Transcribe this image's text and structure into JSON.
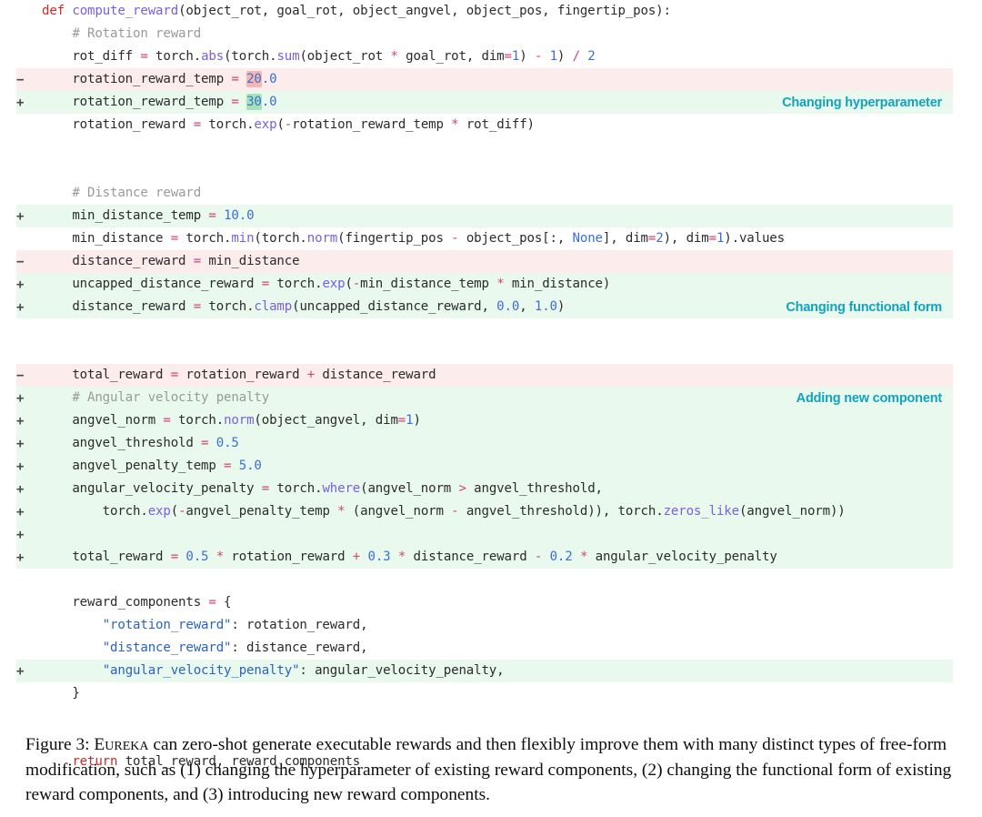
{
  "figure": {
    "label": "Figure 3:",
    "caption_entity": "Eureka",
    "caption_text": " can zero-shot generate executable rewards and then flexibly improve them with many distinct types of free-form modification, such as (1) changing the hyperparameter of existing reward components, (2) changing the functional form of existing reward components, and (3) introducing new reward components."
  },
  "colors": {
    "annotation": "#11a3bd",
    "added_row_bg": "#e9f9ee",
    "deleted_row_bg": "#fceceb",
    "added_token_highlight": "#a7e3b8",
    "deleted_token_highlight": "#f6b7b2",
    "keyword": "#cf2a27",
    "function": "#7b5ee0",
    "operator": "#d6427a",
    "number": "#3b6fd4",
    "string": "#2a62c4",
    "comment": "#9a9a9a"
  },
  "markers": {
    "add": "+",
    "del": "−",
    "none": ""
  },
  "annotations": {
    "hyperparameter": "Changing hyperparameter",
    "functional_form": "Changing functional form",
    "new_component": "Adding new component"
  },
  "code": {
    "lines": [
      {
        "marker": "",
        "type": "ctx",
        "text": "def compute_reward(object_rot, goal_rot, object_angvel, object_pos, fingertip_pos):",
        "annotation": ""
      },
      {
        "marker": "",
        "type": "ctx",
        "text": "    # Rotation reward",
        "annotation": ""
      },
      {
        "marker": "",
        "type": "ctx",
        "text": "    rot_diff = torch.abs(torch.sum(object_rot * goal_rot, dim=1) - 1) / 2",
        "annotation": ""
      },
      {
        "marker": "−",
        "type": "del",
        "text": "    rotation_reward_temp = 20.0",
        "annotation": ""
      },
      {
        "marker": "+",
        "type": "add",
        "text": "    rotation_reward_temp = 30.0",
        "annotation": "Changing hyperparameter"
      },
      {
        "marker": "",
        "type": "ctx",
        "text": "    rotation_reward = torch.exp(-rotation_reward_temp * rot_diff)",
        "annotation": ""
      },
      {
        "marker": "",
        "type": "ctx",
        "text": "",
        "annotation": ""
      },
      {
        "marker": "",
        "type": "ctx",
        "text": "",
        "annotation": ""
      },
      {
        "marker": "",
        "type": "ctx",
        "text": "    # Distance reward",
        "annotation": ""
      },
      {
        "marker": "+",
        "type": "add",
        "text": "    min_distance_temp = 10.0",
        "annotation": ""
      },
      {
        "marker": "",
        "type": "ctx",
        "text": "    min_distance = torch.min(torch.norm(fingertip_pos - object_pos[:, None], dim=2), dim=1).values",
        "annotation": ""
      },
      {
        "marker": "−",
        "type": "del",
        "text": "    distance_reward = min_distance",
        "annotation": ""
      },
      {
        "marker": "+",
        "type": "add",
        "text": "    uncapped_distance_reward = torch.exp(-min_distance_temp * min_distance)",
        "annotation": ""
      },
      {
        "marker": "+",
        "type": "add",
        "text": "    distance_reward = torch.clamp(uncapped_distance_reward, 0.0, 1.0)",
        "annotation": "Changing functional form"
      },
      {
        "marker": "",
        "type": "ctx",
        "text": "",
        "annotation": ""
      },
      {
        "marker": "",
        "type": "ctx",
        "text": "",
        "annotation": ""
      },
      {
        "marker": "−",
        "type": "del",
        "text": "    total_reward = rotation_reward + distance_reward",
        "annotation": ""
      },
      {
        "marker": "+",
        "type": "add",
        "text": "    # Angular velocity penalty",
        "annotation": "Adding new component"
      },
      {
        "marker": "+",
        "type": "add",
        "text": "    angvel_norm = torch.norm(object_angvel, dim=1)",
        "annotation": ""
      },
      {
        "marker": "+",
        "type": "add",
        "text": "    angvel_threshold = 0.5",
        "annotation": ""
      },
      {
        "marker": "+",
        "type": "add",
        "text": "    angvel_penalty_temp = 5.0",
        "annotation": ""
      },
      {
        "marker": "+",
        "type": "add",
        "text": "    angular_velocity_penalty = torch.where(angvel_norm > angvel_threshold,",
        "annotation": ""
      },
      {
        "marker": "+",
        "type": "add",
        "text": "        torch.exp(-angvel_penalty_temp * (angvel_norm - angvel_threshold)), torch.zeros_like(angvel_norm))",
        "annotation": ""
      },
      {
        "marker": "+",
        "type": "add",
        "text": "",
        "annotation": ""
      },
      {
        "marker": "+",
        "type": "add",
        "text": "    total_reward = 0.5 * rotation_reward + 0.3 * distance_reward - 0.2 * angular_velocity_penalty",
        "annotation": ""
      },
      {
        "marker": "",
        "type": "ctx",
        "text": "",
        "annotation": ""
      },
      {
        "marker": "",
        "type": "ctx",
        "text": "    reward_components = {",
        "annotation": ""
      },
      {
        "marker": "",
        "type": "ctx",
        "text": "        \"rotation_reward\": rotation_reward,",
        "annotation": ""
      },
      {
        "marker": "",
        "type": "ctx",
        "text": "        \"distance_reward\": distance_reward,",
        "annotation": ""
      },
      {
        "marker": "+",
        "type": "add",
        "text": "        \"angular_velocity_penalty\": angular_velocity_penalty,",
        "annotation": ""
      },
      {
        "marker": "",
        "type": "ctx",
        "text": "    }",
        "annotation": ""
      },
      {
        "marker": "",
        "type": "ctx",
        "text": "",
        "annotation": ""
      },
      {
        "marker": "",
        "type": "ctx",
        "text": "",
        "annotation": ""
      },
      {
        "marker": "",
        "type": "ctx",
        "text": "    return total_reward, reward_components",
        "annotation": ""
      }
    ]
  }
}
